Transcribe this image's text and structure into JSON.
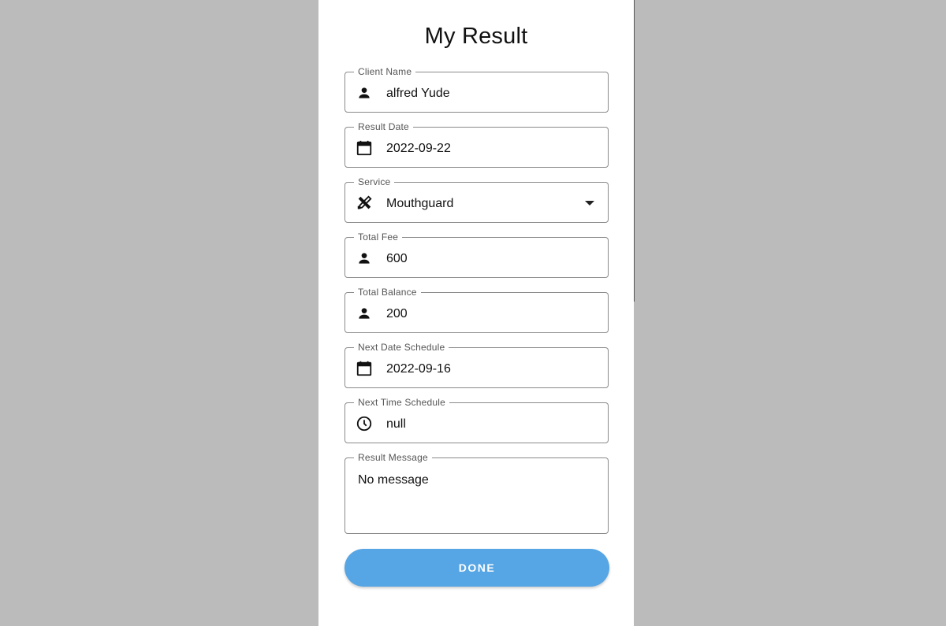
{
  "title": "My Result",
  "fields": {
    "client_name": {
      "label": "Client Name",
      "value": "alfred Yude",
      "icon": "person-icon"
    },
    "result_date": {
      "label": "Result Date",
      "value": "2022-09-22",
      "icon": "calendar-icon"
    },
    "service": {
      "label": "Service",
      "value": "Mouthguard",
      "icon": "dental-tools-icon"
    },
    "total_fee": {
      "label": "Total Fee",
      "value": "600",
      "icon": "person-icon"
    },
    "total_balance": {
      "label": "Total Balance",
      "value": "200",
      "icon": "person-icon"
    },
    "next_date": {
      "label": "Next Date Schedule",
      "value": "2022-09-16",
      "icon": "calendar-icon"
    },
    "next_time": {
      "label": "Next Time Schedule",
      "value": "null",
      "icon": "clock-icon"
    },
    "result_message": {
      "label": "Result Message",
      "value": "No message"
    }
  },
  "done_label": "DONE",
  "colors": {
    "accent": "#56a5e4",
    "background": "#bbbbbb"
  }
}
